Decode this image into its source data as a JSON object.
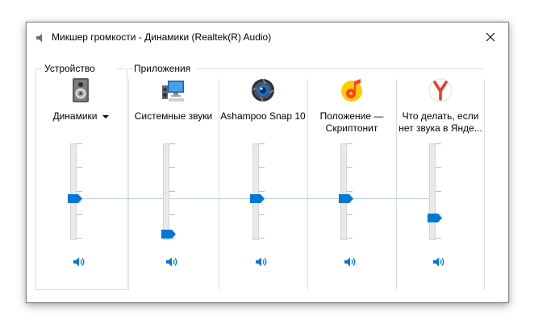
{
  "window": {
    "title": "Микшер громкости - Динамики (Realtek(R) Audio)"
  },
  "groups": {
    "device": "Устройство",
    "apps": "Приложения"
  },
  "channels": [
    {
      "label": "Динамики",
      "icon": "speaker-device-icon",
      "dropdown": true,
      "volume": 0.41
    },
    {
      "label": "Системные звуки",
      "icon": "system-sounds-icon",
      "dropdown": false,
      "volume": 0.0
    },
    {
      "label": "Ashampoo Snap 10",
      "icon": "ashampoo-snap-icon",
      "dropdown": false,
      "volume": 0.41
    },
    {
      "label": "Положение — Скриптонит",
      "icon": "yandex-music-icon",
      "dropdown": false,
      "volume": 0.41
    },
    {
      "label": "Что делать, если нет звука в Янде...",
      "icon": "yandex-browser-icon",
      "dropdown": false,
      "volume": 0.18
    }
  ],
  "colors": {
    "accent": "#0078d7",
    "link": "#b9d4ee"
  }
}
